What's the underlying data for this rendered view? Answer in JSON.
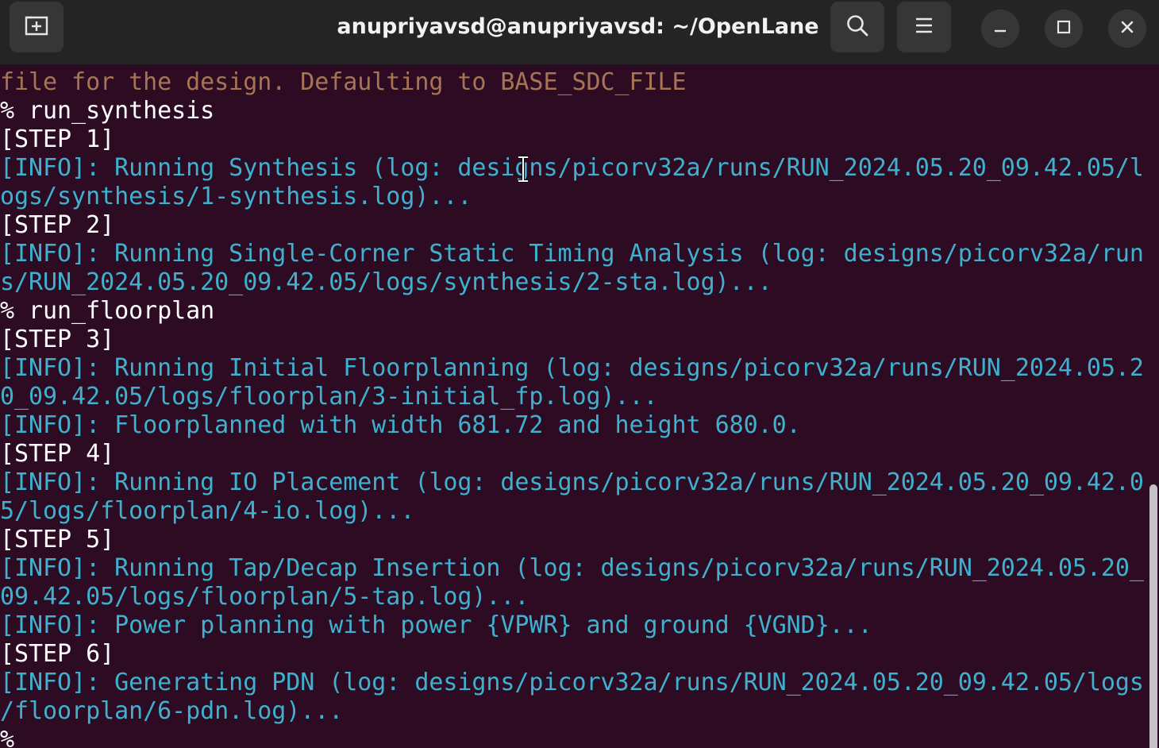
{
  "window": {
    "title": "anupriyavsd@anupriyavsd: ~/OpenLane"
  },
  "icons": {
    "new_tab": "new-tab-icon",
    "search": "search-icon",
    "menu": "hamburger-menu-icon",
    "minimize": "minimize-icon",
    "maximize": "maximize-icon",
    "close": "close-icon"
  },
  "colors": {
    "terminal_bg": "#2c0b23",
    "titlebar_bg": "#242424",
    "info_text": "#3fb1cf",
    "warning_text": "#a77553",
    "default_text": "#ffffff"
  },
  "terminal": {
    "lines": [
      {
        "type": "warn",
        "text": "file for the design. Defaulting to BASE_SDC_FILE"
      },
      {
        "type": "cmd",
        "text": "% run_synthesis"
      },
      {
        "type": "cmd",
        "text": "[STEP 1]"
      },
      {
        "type": "info",
        "text": "[INFO]: Running Synthesis (log: designs/picorv32a/runs/RUN_2024.05.20_09.42.05/l"
      },
      {
        "type": "info",
        "text": "ogs/synthesis/1-synthesis.log)..."
      },
      {
        "type": "cmd",
        "text": "[STEP 2]"
      },
      {
        "type": "info",
        "text": "[INFO]: Running Single-Corner Static Timing Analysis (log: designs/picorv32a/run"
      },
      {
        "type": "info",
        "text": "s/RUN_2024.05.20_09.42.05/logs/synthesis/2-sta.log)..."
      },
      {
        "type": "cmd",
        "text": "% run_floorplan"
      },
      {
        "type": "cmd",
        "text": "[STEP 3]"
      },
      {
        "type": "info",
        "text": "[INFO]: Running Initial Floorplanning (log: designs/picorv32a/runs/RUN_2024.05.2"
      },
      {
        "type": "info",
        "text": "0_09.42.05/logs/floorplan/3-initial_fp.log)..."
      },
      {
        "type": "info",
        "text": "[INFO]: Floorplanned with width 681.72 and height 680.0."
      },
      {
        "type": "cmd",
        "text": "[STEP 4]"
      },
      {
        "type": "info",
        "text": "[INFO]: Running IO Placement (log: designs/picorv32a/runs/RUN_2024.05.20_09.42.0"
      },
      {
        "type": "info",
        "text": "5/logs/floorplan/4-io.log)..."
      },
      {
        "type": "cmd",
        "text": "[STEP 5]"
      },
      {
        "type": "info",
        "text": "[INFO]: Running Tap/Decap Insertion (log: designs/picorv32a/runs/RUN_2024.05.20_"
      },
      {
        "type": "info",
        "text": "09.42.05/logs/floorplan/5-tap.log)..."
      },
      {
        "type": "info",
        "text": "[INFO]: Power planning with power {VPWR} and ground {VGND}..."
      },
      {
        "type": "cmd",
        "text": "[STEP 6]"
      },
      {
        "type": "info",
        "text": "[INFO]: Generating PDN (log: designs/picorv32a/runs/RUN_2024.05.20_09.42.05/logs"
      },
      {
        "type": "info",
        "text": "/floorplan/6-pdn.log)..."
      },
      {
        "type": "cmd",
        "text": "%"
      }
    ]
  }
}
